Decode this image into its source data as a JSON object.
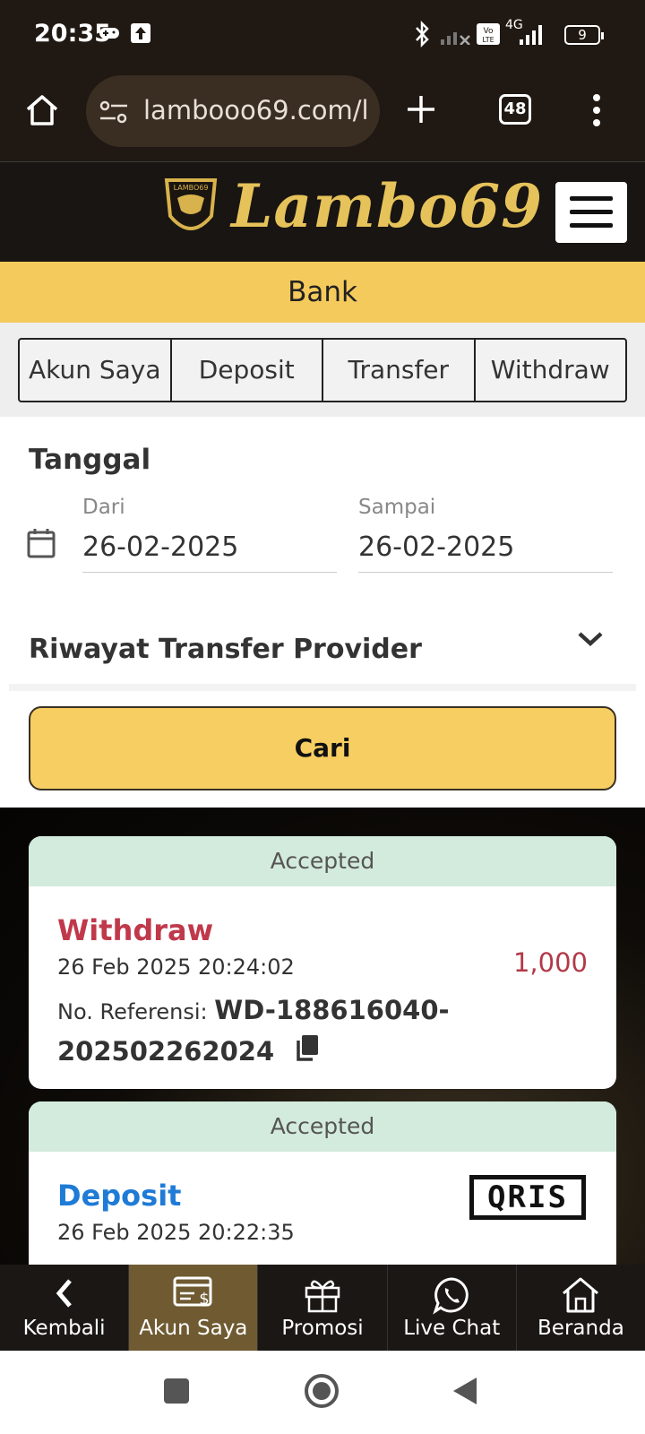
{
  "status_bar": {
    "time": "20:35",
    "network": "4G",
    "battery": "9"
  },
  "browser": {
    "url": "lambooo69.com/l",
    "tab_count": "48"
  },
  "site": {
    "logo": "Lambo69"
  },
  "page": {
    "title": "Bank"
  },
  "tabs": [
    {
      "label": "Akun Saya"
    },
    {
      "label": "Deposit"
    },
    {
      "label": "Transfer"
    },
    {
      "label": "Withdraw"
    }
  ],
  "form": {
    "date_title": "Tanggal",
    "from_label": "Dari",
    "from_value": "26-02-2025",
    "to_label": "Sampai",
    "to_value": "26-02-2025",
    "history_select": "Riwayat Transfer Provider",
    "search_label": "Cari"
  },
  "transactions": [
    {
      "status": "Accepted",
      "type": "Withdraw",
      "date": "26 Feb 2025 20:24:02",
      "amount": "1,000",
      "ref_label": "No. Referensi:",
      "ref_value": "WD-188616040-202502262024"
    },
    {
      "status": "Accepted",
      "type": "Deposit",
      "date": "26 Feb 2025 20:22:35",
      "method": "QRIS"
    }
  ],
  "bottom_nav": [
    {
      "label": "Kembali",
      "icon": "back-chevron-icon"
    },
    {
      "label": "Akun Saya",
      "icon": "account-card-icon"
    },
    {
      "label": "Promosi",
      "icon": "gift-icon"
    },
    {
      "label": "Live Chat",
      "icon": "whatsapp-icon"
    },
    {
      "label": "Beranda",
      "icon": "home-icon"
    }
  ],
  "colors": {
    "accent": "#f5ca5c",
    "withdraw": "#c0394b",
    "deposit": "#1e7bd6",
    "accepted_bg": "#d3ebdc"
  }
}
